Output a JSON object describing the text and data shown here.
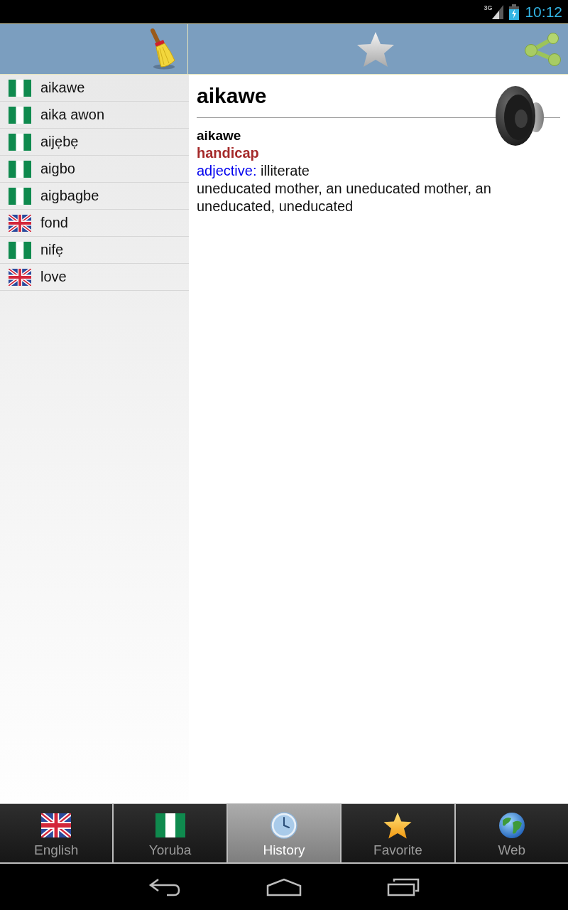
{
  "status_bar": {
    "network": "3G",
    "time": "10:12"
  },
  "entry_toolbar": {
    "favorite": false
  },
  "history": [
    {
      "kind": "yoruba",
      "word": "aikawe"
    },
    {
      "kind": "yoruba",
      "word": "aika awon"
    },
    {
      "kind": "yoruba",
      "word": "aijẹbẹ"
    },
    {
      "kind": "yoruba",
      "word": "aigbo"
    },
    {
      "kind": "yoruba",
      "word": "aigbagbe"
    },
    {
      "kind": "english",
      "word": "fond"
    },
    {
      "kind": "yoruba",
      "word": "nifẹ"
    },
    {
      "kind": "english",
      "word": "love"
    }
  ],
  "entry": {
    "title": "aikawe",
    "headword": "aikawe",
    "translation": "handicap",
    "part_of_speech": "adjective:",
    "meaning": "illiterate",
    "examples": "uneducated mother, an uneducated mother, an uneducated, uneducated"
  },
  "tabs": [
    {
      "kind": "english",
      "label": "English",
      "selected": false
    },
    {
      "kind": "yoruba",
      "label": "Yoruba",
      "selected": false
    },
    {
      "kind": "history",
      "label": "History",
      "selected": true
    },
    {
      "kind": "favorite",
      "label": "Favorite",
      "selected": false
    },
    {
      "kind": "web",
      "label": "Web",
      "selected": false
    }
  ]
}
